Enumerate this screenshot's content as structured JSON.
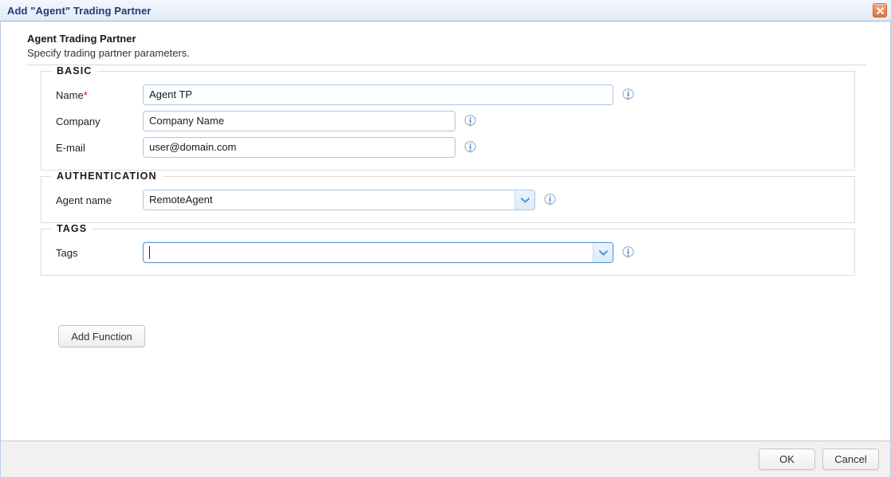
{
  "window": {
    "title": "Add \"Agent\" Trading Partner",
    "close_icon": "close-icon"
  },
  "header": {
    "title": "Agent Trading Partner",
    "subtitle": "Specify trading partner parameters."
  },
  "groups": {
    "basic": {
      "legend": "BASIC",
      "fields": {
        "name": {
          "label": "Name",
          "required_marker": "*",
          "value": "Agent TP",
          "placeholder": "",
          "info_icon": "info-icon"
        },
        "company": {
          "label": "Company",
          "value": "Company Name",
          "placeholder": "",
          "info_icon": "info-icon"
        },
        "email": {
          "label": "E-mail",
          "value": "user@domain.com",
          "placeholder": "",
          "info_icon": "info-icon"
        }
      }
    },
    "authentication": {
      "legend": "AUTHENTICATION",
      "fields": {
        "agent_name": {
          "label": "Agent name",
          "value": "RemoteAgent",
          "placeholder": "",
          "dropdown_icon": "chevron-down-icon",
          "info_icon": "info-icon"
        }
      }
    },
    "tags": {
      "legend": "TAGS",
      "fields": {
        "tags": {
          "label": "Tags",
          "value": "",
          "placeholder": "",
          "dropdown_icon": "chevron-down-icon",
          "info_icon": "info-icon"
        }
      }
    }
  },
  "buttons": {
    "add_function": "Add Function",
    "ok": "OK",
    "cancel": "Cancel"
  },
  "colors": {
    "title_text": "#1f3c75",
    "titlebar_bg": "#e9f0fa",
    "close_button": "#ec8b60",
    "required_asterisk": "#e00000",
    "field_border": "#a9c6e8",
    "field_border_focused": "#5b9bd5",
    "footer_bg": "#f1f1f1",
    "info_icon_blue": "#2b6cb8"
  }
}
